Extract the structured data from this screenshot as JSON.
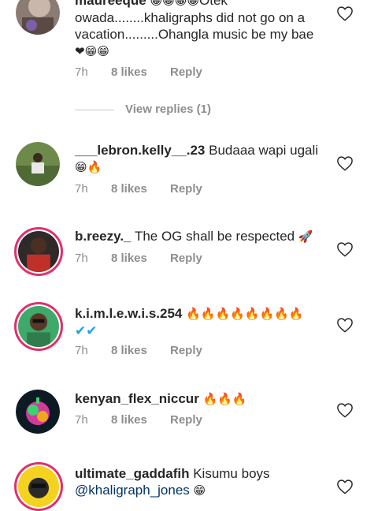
{
  "comments": [
    {
      "username": "maureeque",
      "text": "Otek owada........khaligraphs did not go on a vacation.........Ohangla music be my bae",
      "emoji_lead": "😁😁😁😁",
      "emoji_tail": "❤😁😁",
      "time": "7h",
      "likes": "8 likes",
      "reply": "Reply"
    },
    {
      "username": "___lebron.kelly__.23",
      "text": "Budaaa wapi ugali",
      "emoji_tail": "😁🔥",
      "time": "7h",
      "likes": "8 likes",
      "reply": "Reply"
    },
    {
      "username": "b.reezy._",
      "text": "The OG shall be respected",
      "emoji_tail": "🚀",
      "time": "7h",
      "likes": "8 likes",
      "reply": "Reply"
    },
    {
      "username": "k.i.m.l.e.w.i.s.254",
      "emoji_tail": "🔥🔥🔥🔥🔥🔥🔥🔥",
      "checks": "✔✔",
      "time": "7h",
      "likes": "8 likes",
      "reply": "Reply"
    },
    {
      "username": "kenyan_flex_niccur",
      "emoji_tail": "🔥🔥🔥",
      "time": "7h",
      "likes": "8 likes",
      "reply": "Reply"
    },
    {
      "username": "ultimate_gaddafih",
      "text": "Kisumu boys",
      "mention": "@khaligraph_jones",
      "emoji_tail": "😁"
    }
  ],
  "view_replies": "View replies (1)",
  "icons": {
    "heart": "heart-outline-icon"
  },
  "colors": {
    "story_ring": "#e1306c",
    "mention": "#003569",
    "meta_gray": "#8e8e8e"
  }
}
